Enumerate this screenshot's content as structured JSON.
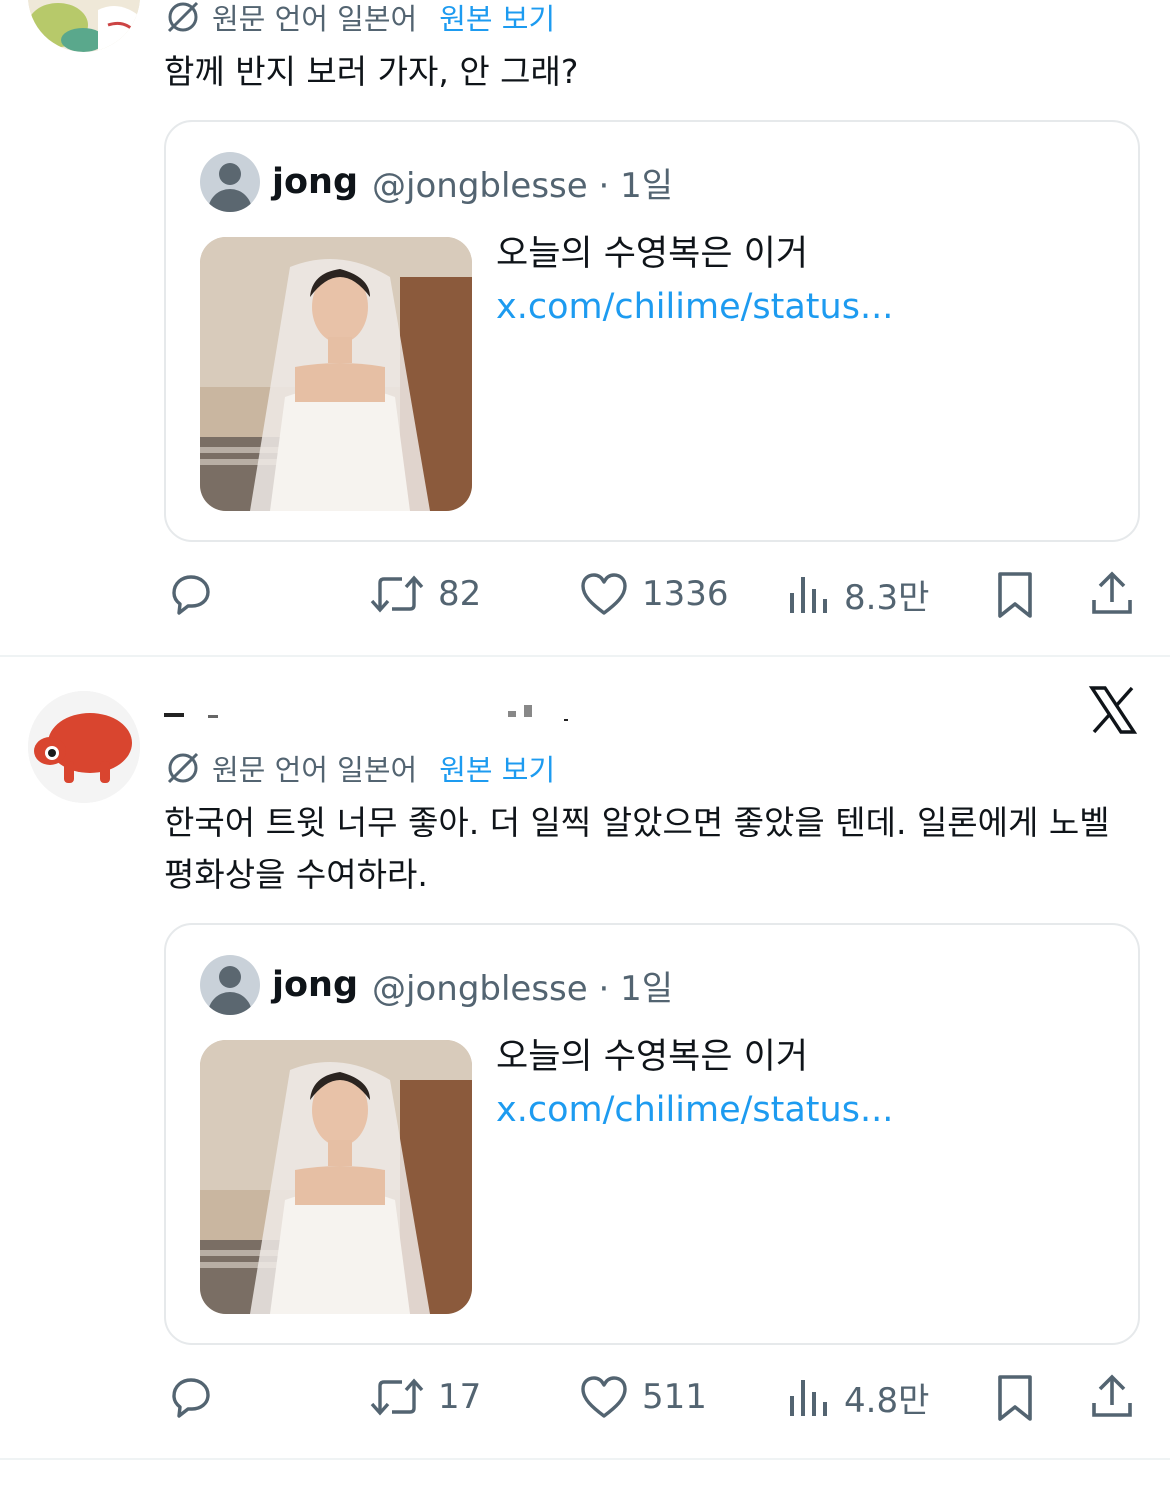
{
  "tweets": [
    {
      "translation": {
        "label": "원문 언어 일본어",
        "link": "원본 보기"
      },
      "text": "함께 반지 보러 가자, 안 그래?",
      "quote": {
        "name": "jong",
        "handle": "@jongblesse · 1일",
        "text": "오늘의 수영복은 이거 ",
        "link": "x.com/chilime/status..."
      },
      "actions": {
        "reply": "",
        "retweets": "82",
        "likes": "1336",
        "views": "8.3만"
      }
    },
    {
      "translation": {
        "label": "원문 언어 일본어",
        "link": "원본 보기"
      },
      "text": "한국어 트윗 너무 좋아. 더 일찍 알았으면 좋았을 텐데. 일론에게 노벨 평화상을 수여하라.",
      "quote": {
        "name": "jong",
        "handle": "@jongblesse · 1일",
        "text": "오늘의 수영복은 이거 ",
        "link": "x.com/chilime/status..."
      },
      "actions": {
        "reply": "",
        "retweets": "17",
        "likes": "511",
        "views": "4.8만"
      }
    }
  ],
  "colors": {
    "link": "#1d9bf0",
    "secondary": "#536471",
    "border": "#e6e9eb",
    "avatar_red": "#d9452f"
  },
  "icons": [
    "translate-icon",
    "reply-icon",
    "retweet-icon",
    "like-icon",
    "views-icon",
    "bookmark-icon",
    "share-icon",
    "x-logo-icon"
  ]
}
